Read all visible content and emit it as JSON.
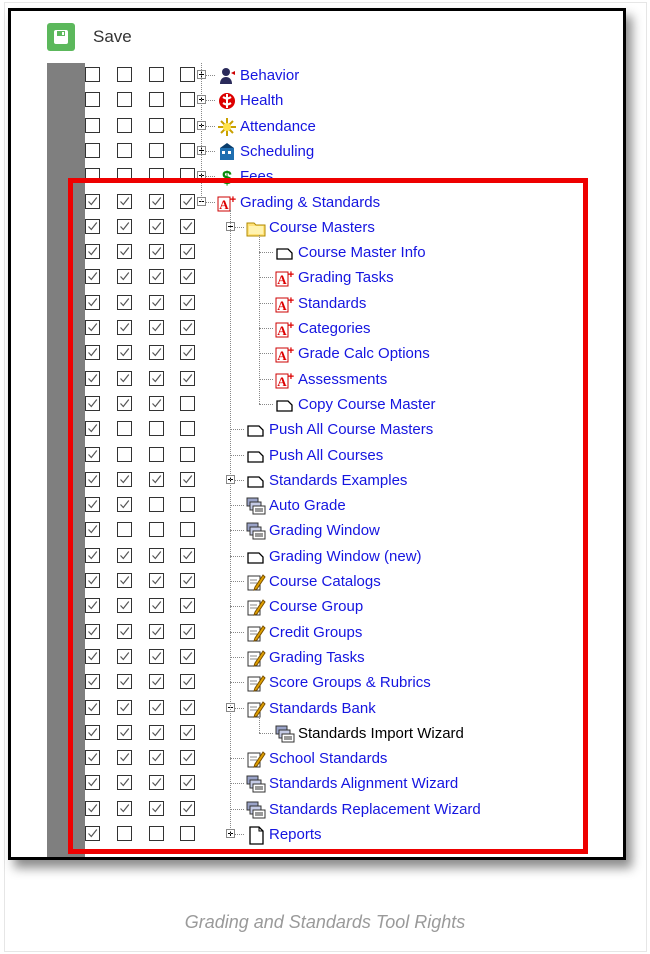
{
  "toolbar": {
    "save_label": "Save"
  },
  "caption": "Grading and Standards Tool Rights",
  "colors": {
    "link": "#1515e0",
    "highlight": "#ee0000",
    "save_green": "#5cb85c",
    "sidebar_gray": "#7f7f7f"
  },
  "tree": [
    {
      "label": "Behavior",
      "level": 0,
      "icon": "behavior-icon",
      "expander": "plus",
      "checks": [
        false,
        false,
        false,
        false
      ]
    },
    {
      "label": "Health",
      "level": 0,
      "icon": "health-icon",
      "expander": "plus",
      "checks": [
        false,
        false,
        false,
        false
      ]
    },
    {
      "label": "Attendance",
      "level": 0,
      "icon": "attendance-icon",
      "expander": "plus",
      "checks": [
        false,
        false,
        false,
        false
      ]
    },
    {
      "label": "Scheduling",
      "level": 0,
      "icon": "scheduling-icon",
      "expander": "plus",
      "checks": [
        false,
        false,
        false,
        false
      ]
    },
    {
      "label": "Fees",
      "level": 0,
      "icon": "fees-icon",
      "expander": "plus",
      "checks": [
        false,
        false,
        false,
        false
      ]
    },
    {
      "label": "Grading & Standards",
      "level": 0,
      "icon": "grading-icon",
      "expander": "minus",
      "checks": [
        true,
        true,
        true,
        true
      ]
    },
    {
      "label": "Course Masters",
      "level": 1,
      "icon": "folder-icon",
      "expander": "minus",
      "checks": [
        true,
        true,
        true,
        true
      ]
    },
    {
      "label": "Course Master Info",
      "level": 2,
      "icon": "page-icon",
      "expander": "none",
      "checks": [
        true,
        true,
        true,
        true
      ]
    },
    {
      "label": "Grading Tasks",
      "level": 2,
      "icon": "grading-icon",
      "expander": "none",
      "checks": [
        true,
        true,
        true,
        true
      ]
    },
    {
      "label": "Standards",
      "level": 2,
      "icon": "grading-icon",
      "expander": "none",
      "checks": [
        true,
        true,
        true,
        true
      ]
    },
    {
      "label": "Categories",
      "level": 2,
      "icon": "grading-icon",
      "expander": "none",
      "checks": [
        true,
        true,
        true,
        true
      ]
    },
    {
      "label": "Grade Calc Options",
      "level": 2,
      "icon": "grading-icon",
      "expander": "none",
      "checks": [
        true,
        true,
        true,
        true
      ]
    },
    {
      "label": "Assessments",
      "level": 2,
      "icon": "grading-icon",
      "expander": "none",
      "checks": [
        true,
        true,
        true,
        true
      ]
    },
    {
      "label": "Copy Course Master",
      "level": 2,
      "icon": "page-icon",
      "expander": "none",
      "checks": [
        true,
        true,
        true,
        false
      ]
    },
    {
      "label": "Push All Course Masters",
      "level": 1,
      "icon": "page-icon",
      "expander": "none",
      "checks": [
        true,
        false,
        false,
        false
      ]
    },
    {
      "label": "Push All Courses",
      "level": 1,
      "icon": "page-icon",
      "expander": "none",
      "checks": [
        true,
        false,
        false,
        false
      ]
    },
    {
      "label": "Standards Examples",
      "level": 1,
      "icon": "page-icon",
      "expander": "plus",
      "checks": [
        true,
        true,
        true,
        true
      ]
    },
    {
      "label": "Auto Grade",
      "level": 1,
      "icon": "wizard-icon",
      "expander": "none",
      "checks": [
        true,
        true,
        false,
        false
      ]
    },
    {
      "label": "Grading Window",
      "level": 1,
      "icon": "wizard-icon",
      "expander": "none",
      "checks": [
        true,
        false,
        false,
        false
      ]
    },
    {
      "label": "Grading Window (new)",
      "level": 1,
      "icon": "page-icon",
      "expander": "none",
      "checks": [
        true,
        true,
        true,
        true
      ]
    },
    {
      "label": "Course Catalogs",
      "level": 1,
      "icon": "edit-icon",
      "expander": "none",
      "checks": [
        true,
        true,
        true,
        true
      ]
    },
    {
      "label": "Course Group",
      "level": 1,
      "icon": "edit-icon",
      "expander": "none",
      "checks": [
        true,
        true,
        true,
        true
      ]
    },
    {
      "label": "Credit Groups",
      "level": 1,
      "icon": "edit-icon",
      "expander": "none",
      "checks": [
        true,
        true,
        true,
        true
      ]
    },
    {
      "label": "Grading Tasks",
      "level": 1,
      "icon": "edit-icon",
      "expander": "none",
      "checks": [
        true,
        true,
        true,
        true
      ]
    },
    {
      "label": "Score Groups & Rubrics",
      "level": 1,
      "icon": "edit-icon",
      "expander": "none",
      "checks": [
        true,
        true,
        true,
        true
      ]
    },
    {
      "label": "Standards Bank",
      "level": 1,
      "icon": "edit-icon",
      "expander": "minus",
      "checks": [
        true,
        true,
        true,
        true
      ]
    },
    {
      "label": "Standards Import Wizard",
      "level": 2,
      "icon": "wizard-icon",
      "expander": "none",
      "dark": true,
      "checks": [
        true,
        true,
        true,
        true
      ]
    },
    {
      "label": "School Standards",
      "level": 1,
      "icon": "edit-icon",
      "expander": "none",
      "checks": [
        true,
        true,
        true,
        true
      ]
    },
    {
      "label": "Standards Alignment Wizard",
      "level": 1,
      "icon": "wizard-icon",
      "expander": "none",
      "checks": [
        true,
        true,
        true,
        true
      ]
    },
    {
      "label": "Standards Replacement Wizard",
      "level": 1,
      "icon": "wizard-icon",
      "expander": "none",
      "checks": [
        true,
        true,
        true,
        true
      ]
    },
    {
      "label": "Reports",
      "level": 1,
      "icon": "report-icon",
      "expander": "plus",
      "checks": [
        true,
        false,
        false,
        false
      ]
    }
  ]
}
